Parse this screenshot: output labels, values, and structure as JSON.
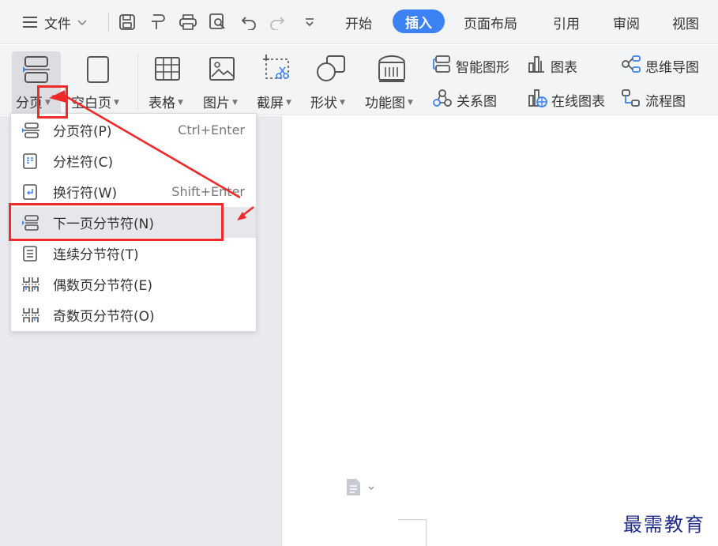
{
  "topbar": {
    "menu_label": "文件",
    "tabs": [
      "开始",
      "插入",
      "页面布局",
      "引用",
      "审阅",
      "视图"
    ],
    "active_tab": "插入"
  },
  "ribbon": {
    "page_break": "分页",
    "blank_page": "空白页",
    "table": "表格",
    "picture": "图片",
    "screenshot": "截屏",
    "shapes": "形状",
    "function_chart": "功能图",
    "smart_art": "智能图形",
    "chart": "图表",
    "mind_map": "思维导图",
    "relation_chart": "关系图",
    "online_chart": "在线图表",
    "flow_chart": "流程图"
  },
  "menu": {
    "items": [
      {
        "label": "分页符(P)",
        "shortcut": "Ctrl+Enter"
      },
      {
        "label": "分栏符(C)",
        "shortcut": ""
      },
      {
        "label": "换行符(W)",
        "shortcut": "Shift+Enter"
      },
      {
        "label": "下一页分节符(N)",
        "shortcut": ""
      },
      {
        "label": "连续分节符(T)",
        "shortcut": ""
      },
      {
        "label": "偶数页分节符(E)",
        "shortcut": ""
      },
      {
        "label": "奇数页分节符(O)",
        "shortcut": ""
      }
    ],
    "highlighted_index": 3
  },
  "watermark": "最需教育",
  "colors": {
    "accent": "#3d82f4",
    "annotation": "#ee2a2a",
    "watermark": "#1f2d8f"
  }
}
